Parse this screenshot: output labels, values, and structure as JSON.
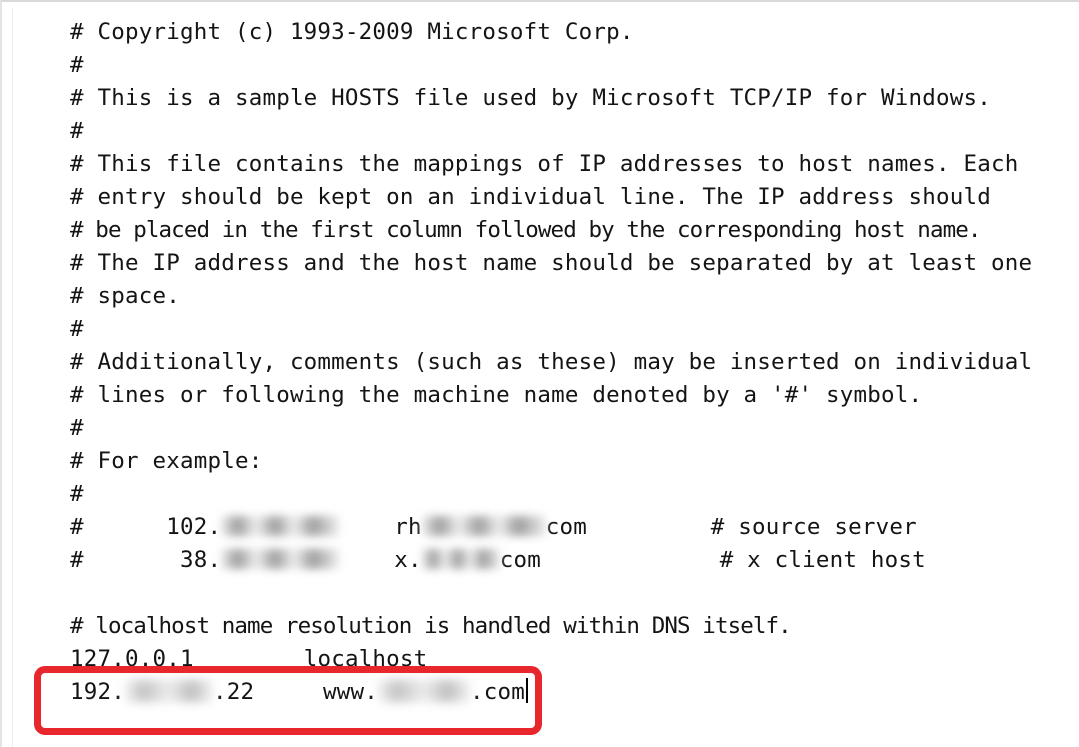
{
  "document": {
    "kind": "hosts-file",
    "lines": [
      {
        "id": "copyright",
        "text": "# Copyright (c) 1993-2009 Microsoft Corp."
      },
      {
        "id": "blank-1",
        "text": "#"
      },
      {
        "id": "intro",
        "text": "# This is a sample HOSTS file used by Microsoft TCP/IP for Windows."
      },
      {
        "id": "blank-2",
        "text": "#"
      },
      {
        "id": "desc-1",
        "text": "# This file contains the mappings of IP addresses to host names. Each"
      },
      {
        "id": "desc-2",
        "text": "# entry should be kept on an individual line. The IP address should"
      },
      {
        "id": "desc-3",
        "text": "# be placed in the first column followed by the corresponding host name."
      },
      {
        "id": "desc-4",
        "text": "# The IP address and the host name should be separated by at least one"
      },
      {
        "id": "desc-5",
        "text": "# space."
      },
      {
        "id": "blank-3",
        "text": "#"
      },
      {
        "id": "comments-1",
        "text": "# Additionally, comments (such as these) may be inserted on individual"
      },
      {
        "id": "comments-2",
        "text": "# lines or following the machine name denoted by a '#' symbol."
      },
      {
        "id": "blank-4",
        "text": "#"
      },
      {
        "id": "for-example",
        "text": "# For example:"
      },
      {
        "id": "blank-5",
        "text": "#"
      }
    ],
    "example_entries": [
      {
        "id": "source-server",
        "comment_marker": "#",
        "ip_prefix": "102.",
        "ip_redacted": true,
        "host_prefix": "rh",
        "host_redacted": true,
        "host_suffix": "com",
        "trailing_comment": "# source server"
      },
      {
        "id": "x-client-host",
        "comment_marker": "#",
        "ip_prefix": "38.",
        "ip_redacted": true,
        "host_prefix": "x.",
        "host_redacted": true,
        "host_suffix": "com",
        "trailing_comment": "# x client host"
      }
    ],
    "footer_lines": [
      {
        "id": "blank-6",
        "text": ""
      },
      {
        "id": "dns-note",
        "text": "# localhost name resolution is handled within DNS itself."
      }
    ],
    "active_entries": [
      {
        "id": "localhost-entry",
        "ip": "127.0.0.1",
        "spacer": "        ",
        "host": "localhost",
        "highlighted": false
      },
      {
        "id": "custom-entry",
        "ip_prefix": "192.",
        "ip_redacted": true,
        "ip_suffix": ".22",
        "spacer": "     ",
        "host_prefix": "www.",
        "host_redacted": true,
        "host_suffix": ".com",
        "highlighted": true,
        "caret_visible": true
      }
    ]
  },
  "annotation": {
    "id": "red-highlight-rectangle",
    "shape": "rounded-rectangle",
    "color": "#e8272c",
    "border_width_px": 7,
    "target": "custom-entry"
  }
}
